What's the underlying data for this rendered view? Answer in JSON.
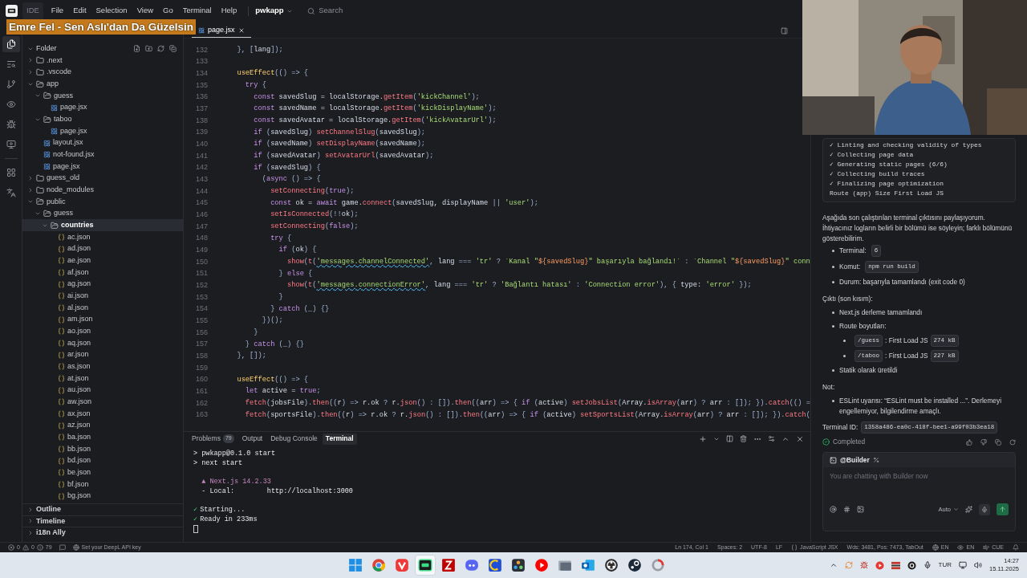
{
  "menu_bar": {
    "app_label": "IDE",
    "menus": [
      "File",
      "Edit",
      "Selection",
      "View",
      "Go",
      "Terminal",
      "Help"
    ],
    "project": "pwkapp",
    "search_placeholder": "Search"
  },
  "now_playing_banner": "Emre Fel - Sen Aslı'dan Da Güzelsin",
  "activity_bar": [
    {
      "kind": "files",
      "selected": true
    },
    {
      "kind": "search",
      "selected": false
    },
    {
      "kind": "git",
      "selected": false
    },
    {
      "kind": "eye",
      "selected": false
    },
    {
      "kind": "bug",
      "selected": false
    },
    {
      "kind": "remote",
      "selected": false
    },
    {
      "kind": "grid",
      "selected": false
    },
    {
      "kind": "translate",
      "selected": false
    }
  ],
  "explorer": {
    "section": "Folder",
    "tree": [
      {
        "kind": "folder",
        "name": ".next",
        "expanded": false,
        "selected": false
      },
      {
        "kind": "folder",
        "name": ".vscode",
        "expanded": false,
        "selected": false
      },
      {
        "kind": "folder",
        "name": "app",
        "expanded": true,
        "selected": false,
        "children": [
          {
            "kind": "folder",
            "name": "guess",
            "expanded": true,
            "selected": false,
            "children": [
              {
                "kind": "jsx",
                "name": "page.jsx",
                "selected": false
              }
            ]
          },
          {
            "kind": "folder",
            "name": "taboo",
            "expanded": true,
            "selected": false,
            "children": [
              {
                "kind": "jsx",
                "name": "page.jsx",
                "selected": false
              }
            ]
          },
          {
            "kind": "jsx",
            "name": "layout.jsx",
            "selected": false
          },
          {
            "kind": "jsx",
            "name": "not-found.jsx",
            "selected": false
          },
          {
            "kind": "jsx",
            "name": "page.jsx",
            "selected": false
          }
        ]
      },
      {
        "kind": "folder",
        "name": "guess_old",
        "expanded": false,
        "selected": false
      },
      {
        "kind": "folder",
        "name": "node_modules",
        "expanded": false,
        "selected": false
      },
      {
        "kind": "folder",
        "name": "public",
        "expanded": true,
        "selected": false,
        "children": [
          {
            "kind": "folder",
            "name": "guess",
            "expanded": true,
            "selected": false,
            "children": [
              {
                "kind": "folder",
                "name": "countries",
                "expanded": true,
                "selected": true,
                "children": [
                  {
                    "kind": "json",
                    "name": "ac.json",
                    "selected": false
                  },
                  {
                    "kind": "json",
                    "name": "ad.json",
                    "selected": false
                  },
                  {
                    "kind": "json",
                    "name": "ae.json",
                    "selected": false
                  },
                  {
                    "kind": "json",
                    "name": "af.json",
                    "selected": false
                  },
                  {
                    "kind": "json",
                    "name": "ag.json",
                    "selected": false
                  },
                  {
                    "kind": "json",
                    "name": "ai.json",
                    "selected": false
                  },
                  {
                    "kind": "json",
                    "name": "al.json",
                    "selected": false
                  },
                  {
                    "kind": "json",
                    "name": "am.json",
                    "selected": false
                  },
                  {
                    "kind": "json",
                    "name": "ao.json",
                    "selected": false
                  },
                  {
                    "kind": "json",
                    "name": "aq.json",
                    "selected": false
                  },
                  {
                    "kind": "json",
                    "name": "ar.json",
                    "selected": false
                  },
                  {
                    "kind": "json",
                    "name": "as.json",
                    "selected": false
                  },
                  {
                    "kind": "json",
                    "name": "at.json",
                    "selected": false
                  },
                  {
                    "kind": "json",
                    "name": "au.json",
                    "selected": false
                  },
                  {
                    "kind": "json",
                    "name": "aw.json",
                    "selected": false
                  },
                  {
                    "kind": "json",
                    "name": "ax.json",
                    "selected": false
                  },
                  {
                    "kind": "json",
                    "name": "az.json",
                    "selected": false
                  },
                  {
                    "kind": "json",
                    "name": "ba.json",
                    "selected": false
                  },
                  {
                    "kind": "json",
                    "name": "bb.json",
                    "selected": false
                  },
                  {
                    "kind": "json",
                    "name": "bd.json",
                    "selected": false
                  },
                  {
                    "kind": "json",
                    "name": "be.json",
                    "selected": false
                  },
                  {
                    "kind": "json",
                    "name": "bf.json",
                    "selected": false
                  },
                  {
                    "kind": "json",
                    "name": "bg.json",
                    "selected": false
                  }
                ]
              }
            ]
          }
        ]
      }
    ],
    "collapsed_sections": [
      "Outline",
      "Timeline",
      "i18n Ally"
    ]
  },
  "editor": {
    "tabs": [
      {
        "label": "page.jsx",
        "selected": true
      }
    ],
    "lines": [
      {
        "number": "132",
        "tokens": [
          {
            "kind": "p",
            "text": "  }, ["
          },
          {
            "kind": "v",
            "text": "lang"
          },
          {
            "kind": "p",
            "text": "]);"
          }
        ]
      },
      {
        "number": "133"
      },
      {
        "number": "134",
        "tokens": [
          {
            "kind": "hook",
            "text": "  useEffect"
          },
          {
            "kind": "p",
            "text": "(() => {"
          }
        ]
      },
      {
        "number": "135",
        "tokens": [
          {
            "kind": "kw",
            "text": "    try"
          },
          {
            "kind": "p",
            "text": " {"
          }
        ]
      },
      {
        "number": "136",
        "tokens": [
          {
            "kind": "kw",
            "text": "      const "
          },
          {
            "kind": "v",
            "text": "savedSlug = localStorage."
          },
          {
            "kind": "fn",
            "text": "getItem"
          },
          {
            "kind": "p",
            "text": "("
          },
          {
            "kind": "str",
            "text": "'kickChannel'"
          },
          {
            "kind": "p",
            "text": ");"
          }
        ]
      },
      {
        "number": "137",
        "tokens": [
          {
            "kind": "kw",
            "text": "      const "
          },
          {
            "kind": "v",
            "text": "savedName = localStorage."
          },
          {
            "kind": "fn",
            "text": "getItem"
          },
          {
            "kind": "p",
            "text": "("
          },
          {
            "kind": "str",
            "text": "'kickDisplayName'"
          },
          {
            "kind": "p",
            "text": ");"
          }
        ]
      },
      {
        "number": "138",
        "tokens": [
          {
            "kind": "kw",
            "text": "      const "
          },
          {
            "kind": "v",
            "text": "savedAvatar = localStorage."
          },
          {
            "kind": "fn",
            "text": "getItem"
          },
          {
            "kind": "p",
            "text": "("
          },
          {
            "kind": "str",
            "text": "'kickAvatarUrl'"
          },
          {
            "kind": "p",
            "text": ");"
          }
        ]
      },
      {
        "number": "139",
        "tokens": [
          {
            "kind": "kw",
            "text": "      if "
          },
          {
            "kind": "p",
            "text": "("
          },
          {
            "kind": "v",
            "text": "savedSlug"
          },
          {
            "kind": "p",
            "text": ") "
          },
          {
            "kind": "fn",
            "text": "setChannelSlug"
          },
          {
            "kind": "p",
            "text": "("
          },
          {
            "kind": "v",
            "text": "savedSlug"
          },
          {
            "kind": "p",
            "text": ");"
          }
        ]
      },
      {
        "number": "140",
        "tokens": [
          {
            "kind": "kw",
            "text": "      if "
          },
          {
            "kind": "p",
            "text": "("
          },
          {
            "kind": "v",
            "text": "savedName"
          },
          {
            "kind": "p",
            "text": ") "
          },
          {
            "kind": "fn",
            "text": "setDisplayName"
          },
          {
            "kind": "p",
            "text": "("
          },
          {
            "kind": "v",
            "text": "savedName"
          },
          {
            "kind": "p",
            "text": ");"
          }
        ]
      },
      {
        "number": "141",
        "tokens": [
          {
            "kind": "kw",
            "text": "      if "
          },
          {
            "kind": "p",
            "text": "("
          },
          {
            "kind": "v",
            "text": "savedAvatar"
          },
          {
            "kind": "p",
            "text": ") "
          },
          {
            "kind": "fn",
            "text": "setAvatarUrl"
          },
          {
            "kind": "p",
            "text": "("
          },
          {
            "kind": "v",
            "text": "savedAvatar"
          },
          {
            "kind": "p",
            "text": ");"
          }
        ]
      },
      {
        "number": "142",
        "tokens": [
          {
            "kind": "kw",
            "text": "      if "
          },
          {
            "kind": "p",
            "text": "("
          },
          {
            "kind": "v",
            "text": "savedSlug"
          },
          {
            "kind": "p",
            "text": ") {"
          }
        ]
      },
      {
        "number": "143",
        "tokens": [
          {
            "kind": "p",
            "text": "        ("
          },
          {
            "kind": "kw",
            "text": "async "
          },
          {
            "kind": "p",
            "text": "() => {"
          }
        ]
      },
      {
        "number": "144",
        "tokens": [
          {
            "kind": "fn",
            "text": "          setConnecting"
          },
          {
            "kind": "p",
            "text": "("
          },
          {
            "kind": "kw",
            "text": "true"
          },
          {
            "kind": "p",
            "text": ");"
          }
        ]
      },
      {
        "number": "145",
        "tokens": [
          {
            "kind": "kw",
            "text": "          const "
          },
          {
            "kind": "v",
            "text": "ok = "
          },
          {
            "kind": "kw",
            "text": "await "
          },
          {
            "kind": "v",
            "text": "game."
          },
          {
            "kind": "fn",
            "text": "connect"
          },
          {
            "kind": "p",
            "text": "("
          },
          {
            "kind": "v",
            "text": "savedSlug, displayName "
          },
          {
            "kind": "p",
            "text": "|| "
          },
          {
            "kind": "str",
            "text": "'user'"
          },
          {
            "kind": "p",
            "text": ");"
          }
        ]
      },
      {
        "number": "146",
        "tokens": [
          {
            "kind": "fn",
            "text": "          setIsConnected"
          },
          {
            "kind": "p",
            "text": "(!!"
          },
          {
            "kind": "v",
            "text": "ok"
          },
          {
            "kind": "p",
            "text": ");"
          }
        ]
      },
      {
        "number": "147",
        "tokens": [
          {
            "kind": "fn",
            "text": "          setConnecting"
          },
          {
            "kind": "p",
            "text": "("
          },
          {
            "kind": "kw",
            "text": "false"
          },
          {
            "kind": "p",
            "text": ");"
          }
        ]
      },
      {
        "number": "148",
        "tokens": [
          {
            "kind": "kw",
            "text": "          try"
          },
          {
            "kind": "p",
            "text": " {"
          }
        ]
      },
      {
        "number": "149",
        "tokens": [
          {
            "kind": "kw",
            "text": "            if "
          },
          {
            "kind": "p",
            "text": "("
          },
          {
            "kind": "v",
            "text": "ok"
          },
          {
            "kind": "p",
            "text": ") {"
          }
        ]
      },
      {
        "number": "150",
        "tokens": [
          {
            "kind": "fn",
            "text": "              show"
          },
          {
            "kind": "p",
            "text": "("
          },
          {
            "kind": "fn",
            "text": "t"
          },
          {
            "kind": "p",
            "text": "("
          },
          {
            "kind": "sq",
            "text": "'messages.channelConnected'"
          },
          {
            "kind": "p",
            "text": ", "
          },
          {
            "kind": "v",
            "text": "lang "
          },
          {
            "kind": "p",
            "text": "=== "
          },
          {
            "kind": "str",
            "text": "'tr' "
          },
          {
            "kind": "p",
            "text": "? "
          },
          {
            "kind": "str",
            "text": "`Kanal \""
          },
          {
            "kind": "tv",
            "text": "${savedSlug}"
          },
          {
            "kind": "str",
            "text": "\" başarıyla bağlandı!` "
          },
          {
            "kind": "p",
            "text": ": "
          },
          {
            "kind": "str",
            "text": "`Channel \""
          },
          {
            "kind": "tv",
            "text": "${savedSlug}"
          },
          {
            "kind": "str",
            "text": "\" conn"
          }
        ]
      },
      {
        "number": "151",
        "tokens": [
          {
            "kind": "p",
            "text": "            } "
          },
          {
            "kind": "kw",
            "text": "else"
          },
          {
            "kind": "p",
            "text": " {"
          }
        ]
      },
      {
        "number": "152",
        "tokens": [
          {
            "kind": "fn",
            "text": "              show"
          },
          {
            "kind": "p",
            "text": "("
          },
          {
            "kind": "fn",
            "text": "t"
          },
          {
            "kind": "p",
            "text": "("
          },
          {
            "kind": "sq",
            "text": "'messages.connectionError'"
          },
          {
            "kind": "p",
            "text": ", "
          },
          {
            "kind": "v",
            "text": "lang "
          },
          {
            "kind": "p",
            "text": "=== "
          },
          {
            "kind": "str",
            "text": "'tr' "
          },
          {
            "kind": "p",
            "text": "? "
          },
          {
            "kind": "str",
            "text": "'Bağlantı hatası' "
          },
          {
            "kind": "p",
            "text": ": "
          },
          {
            "kind": "str",
            "text": "'Connection error'"
          },
          {
            "kind": "p",
            "text": "), { "
          },
          {
            "kind": "v",
            "text": "type: "
          },
          {
            "kind": "str",
            "text": "'error' "
          },
          {
            "kind": "p",
            "text": "});"
          }
        ]
      },
      {
        "number": "153",
        "tokens": [
          {
            "kind": "p",
            "text": "            }"
          }
        ]
      },
      {
        "number": "154",
        "tokens": [
          {
            "kind": "p",
            "text": "          } "
          },
          {
            "kind": "kw",
            "text": "catch "
          },
          {
            "kind": "p",
            "text": "(_) {}"
          }
        ]
      },
      {
        "number": "155",
        "tokens": [
          {
            "kind": "p",
            "text": "        })();"
          }
        ]
      },
      {
        "number": "156",
        "tokens": [
          {
            "kind": "p",
            "text": "      }"
          }
        ]
      },
      {
        "number": "157",
        "tokens": [
          {
            "kind": "p",
            "text": "    } "
          },
          {
            "kind": "kw",
            "text": "catch "
          },
          {
            "kind": "p",
            "text": "(_) {}"
          }
        ]
      },
      {
        "number": "158",
        "tokens": [
          {
            "kind": "p",
            "text": "  }, []);"
          }
        ]
      },
      {
        "number": "159"
      },
      {
        "number": "160",
        "tokens": [
          {
            "kind": "hook",
            "text": "  useEffect"
          },
          {
            "kind": "p",
            "text": "(() => {"
          }
        ]
      },
      {
        "number": "161",
        "tokens": [
          {
            "kind": "kw",
            "text": "    let "
          },
          {
            "kind": "v",
            "text": "active = "
          },
          {
            "kind": "kw",
            "text": "true"
          },
          {
            "kind": "p",
            "text": ";"
          }
        ]
      },
      {
        "number": "162",
        "tokens": [
          {
            "kind": "fn",
            "text": "    fetch"
          },
          {
            "kind": "p",
            "text": "("
          },
          {
            "kind": "v",
            "text": "jobsFile"
          },
          {
            "kind": "p",
            "text": ")."
          },
          {
            "kind": "fn",
            "text": "then"
          },
          {
            "kind": "p",
            "text": "(("
          },
          {
            "kind": "v",
            "text": "r"
          },
          {
            "kind": "p",
            "text": ") => "
          },
          {
            "kind": "v",
            "text": "r.ok "
          },
          {
            "kind": "p",
            "text": "? "
          },
          {
            "kind": "v",
            "text": "r."
          },
          {
            "kind": "fn",
            "text": "json"
          },
          {
            "kind": "p",
            "text": "() : [])."
          },
          {
            "kind": "fn",
            "text": "then"
          },
          {
            "kind": "p",
            "text": "(("
          },
          {
            "kind": "v",
            "text": "arr"
          },
          {
            "kind": "p",
            "text": ") => { "
          },
          {
            "kind": "kw",
            "text": "if "
          },
          {
            "kind": "p",
            "text": "("
          },
          {
            "kind": "v",
            "text": "active"
          },
          {
            "kind": "p",
            "text": ") "
          },
          {
            "kind": "fn",
            "text": "setJobsList"
          },
          {
            "kind": "p",
            "text": "("
          },
          {
            "kind": "v",
            "text": "Array."
          },
          {
            "kind": "fn",
            "text": "isArray"
          },
          {
            "kind": "p",
            "text": "("
          },
          {
            "kind": "v",
            "text": "arr"
          },
          {
            "kind": "p",
            "text": ") ? "
          },
          {
            "kind": "v",
            "text": "arr "
          },
          {
            "kind": "p",
            "text": ": []); })."
          },
          {
            "kind": "fn",
            "text": "catch"
          },
          {
            "kind": "p",
            "text": "(() ="
          }
        ]
      },
      {
        "number": "163",
        "tokens": [
          {
            "kind": "fn",
            "text": "    fetch"
          },
          {
            "kind": "p",
            "text": "("
          },
          {
            "kind": "v",
            "text": "sportsFile"
          },
          {
            "kind": "p",
            "text": ")."
          },
          {
            "kind": "fn",
            "text": "then"
          },
          {
            "kind": "p",
            "text": "(("
          },
          {
            "kind": "v",
            "text": "r"
          },
          {
            "kind": "p",
            "text": ") => "
          },
          {
            "kind": "v",
            "text": "r.ok "
          },
          {
            "kind": "p",
            "text": "? "
          },
          {
            "kind": "v",
            "text": "r."
          },
          {
            "kind": "fn",
            "text": "json"
          },
          {
            "kind": "p",
            "text": "() : [])."
          },
          {
            "kind": "fn",
            "text": "then"
          },
          {
            "kind": "p",
            "text": "(("
          },
          {
            "kind": "v",
            "text": "arr"
          },
          {
            "kind": "p",
            "text": ") => { "
          },
          {
            "kind": "kw",
            "text": "if "
          },
          {
            "kind": "p",
            "text": "("
          },
          {
            "kind": "v",
            "text": "active"
          },
          {
            "kind": "p",
            "text": ") "
          },
          {
            "kind": "fn",
            "text": "setSportsList"
          },
          {
            "kind": "p",
            "text": "("
          },
          {
            "kind": "v",
            "text": "Array."
          },
          {
            "kind": "fn",
            "text": "isArray"
          },
          {
            "kind": "p",
            "text": "("
          },
          {
            "kind": "v",
            "text": "arr"
          },
          {
            "kind": "p",
            "text": ") ? "
          },
          {
            "kind": "v",
            "text": "arr "
          },
          {
            "kind": "p",
            "text": ": []); })."
          },
          {
            "kind": "fn",
            "text": "catch"
          },
          {
            "kind": "p",
            "text": "("
          }
        ]
      }
    ]
  },
  "panel": {
    "tabs": [
      {
        "label": "Problems",
        "badge": "79",
        "selected": false
      },
      {
        "label": "Output",
        "selected": false
      },
      {
        "label": "Debug Console",
        "selected": false
      },
      {
        "label": "Terminal",
        "selected": true
      }
    ],
    "terminal_blocks": [
      [
        {
          "kind": "plain",
          "text": "> pwkapp@0.1.0 start"
        },
        {
          "kind": "plain",
          "text": "> next start"
        }
      ],
      [
        {
          "kind": "accent",
          "text": "  ▲ Next.js 14.2.33"
        },
        {
          "kind": "plain",
          "text": "  - Local:        http://localhost:3000"
        }
      ],
      [
        {
          "kind": "ok",
          "mark": "✓",
          "text": "Starting..."
        },
        {
          "kind": "ok",
          "mark": "✓",
          "text": "Ready in 233ms"
        }
      ]
    ]
  },
  "chat": {
    "output_lines": [
      "✓ Linting and checking validity of types",
      "✓ Collecting page data",
      "✓ Generating static pages (6/6)",
      "✓ Collecting build traces",
      "✓ Finalizing page optimization",
      "Route (app) Size First Load JS"
    ],
    "intro": "Aşağıda son çalıştırılan terminal çıktısını paylaşıyorum. İhtiyacınız logların belirli bir bölümü ise söyleyin; farklı bölümünü gösterebilirim.",
    "details": [
      {
        "text": "Terminal:",
        "code": "6"
      },
      {
        "text": "Komut:",
        "code": "npm run build"
      },
      {
        "text": "Durum: başarıyla tamamlandı (exit code 0)"
      }
    ],
    "output_heading": "Çıktı (son kısım):",
    "output_items": [
      {
        "text": "Next.js derleme tamamlandı"
      },
      {
        "text": "Route boyutları:",
        "children": [
          {
            "code": "/guess",
            "text": ": First Load JS",
            "size": "274 kB"
          },
          {
            "code": "/taboo",
            "text": ": First Load JS",
            "size": "227 kB"
          }
        ]
      },
      {
        "text": "Statik olarak üretildi"
      }
    ],
    "note_heading": "Not:",
    "notes": [
      "ESLint uyarısı: “ESLint must be installed ...”. Derlemeyi engellemiyor, bilgilendirme amaçlı."
    ],
    "terminal_id": {
      "label": "Terminal ID:",
      "value": "1358a486-ea0c-418f-bee1-a99f03b3ea18"
    },
    "status": "Completed",
    "composer": {
      "agent": "@Builder",
      "placeholder": "You are chatting with Builder now",
      "mode": "Auto"
    }
  },
  "status_bar": {
    "errors": "0",
    "warnings": "0",
    "infos": "79",
    "deepl": "Set your DeepL API key",
    "right": [
      {
        "kind": "text",
        "text": "Ln 174, Col 1"
      },
      {
        "kind": "text",
        "text": "Spaces: 2"
      },
      {
        "kind": "text",
        "text": "UTF-8"
      },
      {
        "kind": "text",
        "text": "LF"
      },
      {
        "kind": "braces",
        "text": "JavaScript JSX"
      },
      {
        "kind": "text",
        "text": "Wds: 3481, Pos: 7473, TabOut"
      },
      {
        "kind": "globe",
        "text": "EN"
      },
      {
        "kind": "eye",
        "text": "EN"
      },
      {
        "kind": "wind",
        "text": "CUE"
      },
      {
        "kind": "bell"
      }
    ]
  },
  "taskbar": {
    "apps": [
      {
        "kind": "windows",
        "selected": false
      },
      {
        "kind": "chrome",
        "selected": false
      },
      {
        "kind": "vivaldi",
        "selected": false
      },
      {
        "kind": "ide",
        "selected": true
      },
      {
        "kind": "filezilla",
        "selected": false
      },
      {
        "kind": "discord",
        "selected": false
      },
      {
        "kind": "cursor",
        "selected": false
      },
      {
        "kind": "davinci",
        "selected": false
      },
      {
        "kind": "ytmusic",
        "selected": false
      },
      {
        "kind": "files",
        "selected": false
      },
      {
        "kind": "mail",
        "selected": false
      },
      {
        "kind": "obs",
        "selected": false
      },
      {
        "kind": "steam",
        "selected": false
      },
      {
        "kind": "ring",
        "selected": false
      }
    ],
    "language": "TUR",
    "time": "14:27",
    "date": "15.11.2025"
  }
}
